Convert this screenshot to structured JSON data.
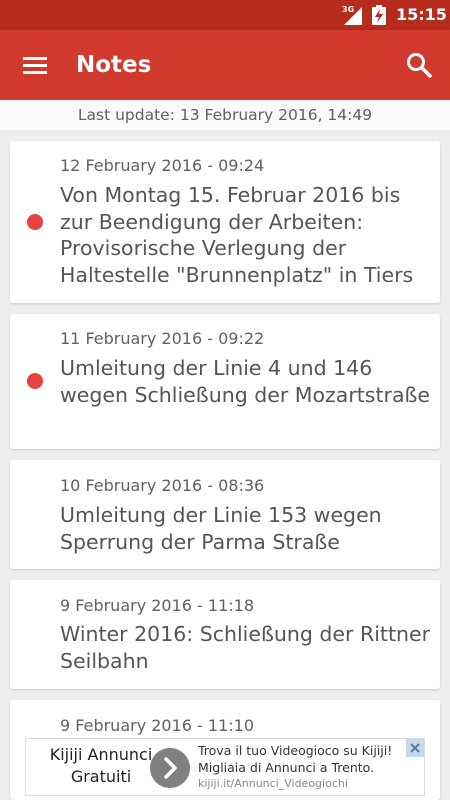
{
  "status_bar": {
    "network": "3G",
    "time": "15:15",
    "icons": [
      "signal-icon",
      "battery-charging-icon"
    ]
  },
  "app_bar": {
    "title": "Notes",
    "icons": [
      "menu-icon",
      "search-icon"
    ],
    "color": "#d0392b"
  },
  "last_update": "Last update: 13 February 2016, 14:49",
  "notes": [
    {
      "date": "12 February 2016 - 09:24",
      "text": "Von Montag 15. Februar 2016 bis zur Beendigung der Arbeiten: Provisorische Verlegung der Haltestelle \"Brunnenplatz\" in Tiers",
      "unread": true
    },
    {
      "date": "11 February 2016 - 09:22",
      "text": "Umleitung der Linie 4 und 146 wegen Schließung der Mozartstraße",
      "unread": true
    },
    {
      "date": "10 February 2016 - 08:36",
      "text": "Umleitung der Linie 153 wegen Sperrung der Parma Straße",
      "unread": false
    },
    {
      "date": "9 February 2016 - 11:18",
      "text": "Winter 2016: Schließung der Rittner Seilbahn",
      "unread": false
    },
    {
      "date": "9 February 2016 - 11:10",
      "text": "",
      "unread": false
    }
  ],
  "ad": {
    "brand": "Kijiji Annunci Gratuiti",
    "line1": "Trova il tuo Videogioco su Kijiji!",
    "line2": "Migliaia di Annunci a Trento.",
    "url": "kijiji.it/Annunci_Videogiochi",
    "icons": [
      "chevron-right-icon",
      "close-icon"
    ]
  },
  "colors": {
    "accent": "#d0392b",
    "status_bar": "#b52b1e",
    "unread_dot": "#e84141"
  }
}
